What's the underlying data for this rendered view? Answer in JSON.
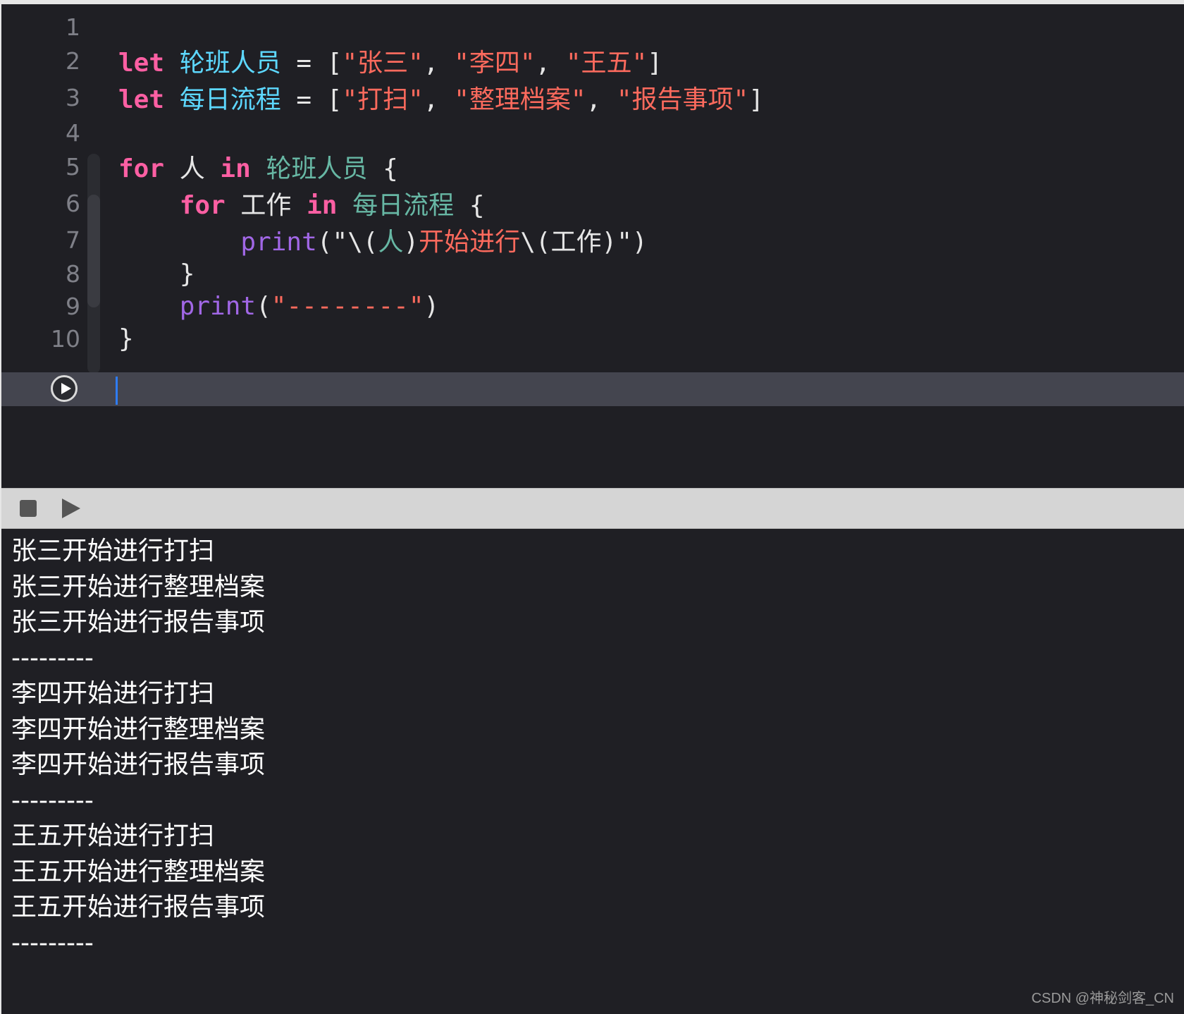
{
  "editor": {
    "lines": [
      {
        "num": "1",
        "segments": []
      },
      {
        "num": "2",
        "segments": [
          {
            "t": "let",
            "c": "kw"
          },
          {
            "t": " ",
            "c": "plain"
          },
          {
            "t": "轮班人员",
            "c": "decl"
          },
          {
            "t": " = [",
            "c": "plain"
          },
          {
            "t": "\"张三\"",
            "c": "str"
          },
          {
            "t": ", ",
            "c": "plain"
          },
          {
            "t": "\"李四\"",
            "c": "str"
          },
          {
            "t": ", ",
            "c": "plain"
          },
          {
            "t": "\"王五\"",
            "c": "str"
          },
          {
            "t": "]",
            "c": "plain"
          }
        ]
      },
      {
        "num": "3",
        "segments": [
          {
            "t": "let",
            "c": "kw"
          },
          {
            "t": " ",
            "c": "plain"
          },
          {
            "t": "每日流程",
            "c": "decl"
          },
          {
            "t": " = [",
            "c": "plain"
          },
          {
            "t": "\"打扫\"",
            "c": "str"
          },
          {
            "t": ", ",
            "c": "plain"
          },
          {
            "t": "\"整理档案\"",
            "c": "str"
          },
          {
            "t": ", ",
            "c": "plain"
          },
          {
            "t": "\"报告事项\"",
            "c": "str"
          },
          {
            "t": "]",
            "c": "plain"
          }
        ]
      },
      {
        "num": "4",
        "segments": []
      },
      {
        "num": "5",
        "segments": [
          {
            "t": "for",
            "c": "kw"
          },
          {
            "t": " 人 ",
            "c": "plain"
          },
          {
            "t": "in",
            "c": "kw"
          },
          {
            "t": " ",
            "c": "plain"
          },
          {
            "t": "轮班人员",
            "c": "ident"
          },
          {
            "t": " {",
            "c": "plain"
          }
        ]
      },
      {
        "num": "6",
        "segments": [
          {
            "t": "    ",
            "c": "plain"
          },
          {
            "t": "for",
            "c": "kw"
          },
          {
            "t": " 工作 ",
            "c": "plain"
          },
          {
            "t": "in",
            "c": "kw"
          },
          {
            "t": " ",
            "c": "plain"
          },
          {
            "t": "每日流程",
            "c": "ident"
          },
          {
            "t": " {",
            "c": "plain"
          }
        ]
      },
      {
        "num": "7",
        "segments": [
          {
            "t": "        ",
            "c": "plain"
          },
          {
            "t": "print",
            "c": "fn"
          },
          {
            "t": "(\"\\(",
            "c": "plain"
          },
          {
            "t": "人",
            "c": "ident"
          },
          {
            "t": ")",
            "c": "plain"
          },
          {
            "t": "开始进行",
            "c": "str"
          },
          {
            "t": "\\(工作)\")",
            "c": "plain"
          }
        ]
      },
      {
        "num": "8",
        "segments": [
          {
            "t": "    }",
            "c": "plain"
          }
        ]
      },
      {
        "num": "9",
        "segments": [
          {
            "t": "    ",
            "c": "plain"
          },
          {
            "t": "print",
            "c": "fn"
          },
          {
            "t": "(",
            "c": "plain"
          },
          {
            "t": "\"--------\"",
            "c": "str"
          },
          {
            "t": ")",
            "c": "plain"
          }
        ]
      },
      {
        "num": "10",
        "segments": [
          {
            "t": "}",
            "c": "plain"
          }
        ]
      }
    ]
  },
  "console": {
    "lines": [
      "张三开始进行打扫",
      "张三开始进行整理档案",
      "张三开始进行报告事项",
      "---------",
      "李四开始进行打扫",
      "李四开始进行整理档案",
      "李四开始进行报告事项",
      "---------",
      "王五开始进行打扫",
      "王五开始进行整理档案",
      "王五开始进行报告事项",
      "---------"
    ]
  },
  "icons": {
    "run": "play-circle-icon",
    "stop": "stop-icon",
    "play": "play-icon"
  },
  "colors": {
    "background": "#1f1f24",
    "keyword": "#fc5fa3",
    "declaration": "#5dd8ff",
    "identifier": "#67b7a4",
    "function": "#a167e6",
    "string": "#fc6a5d",
    "cursor": "#2f7cf6"
  },
  "watermark": "CSDN @神秘剑客_CN"
}
